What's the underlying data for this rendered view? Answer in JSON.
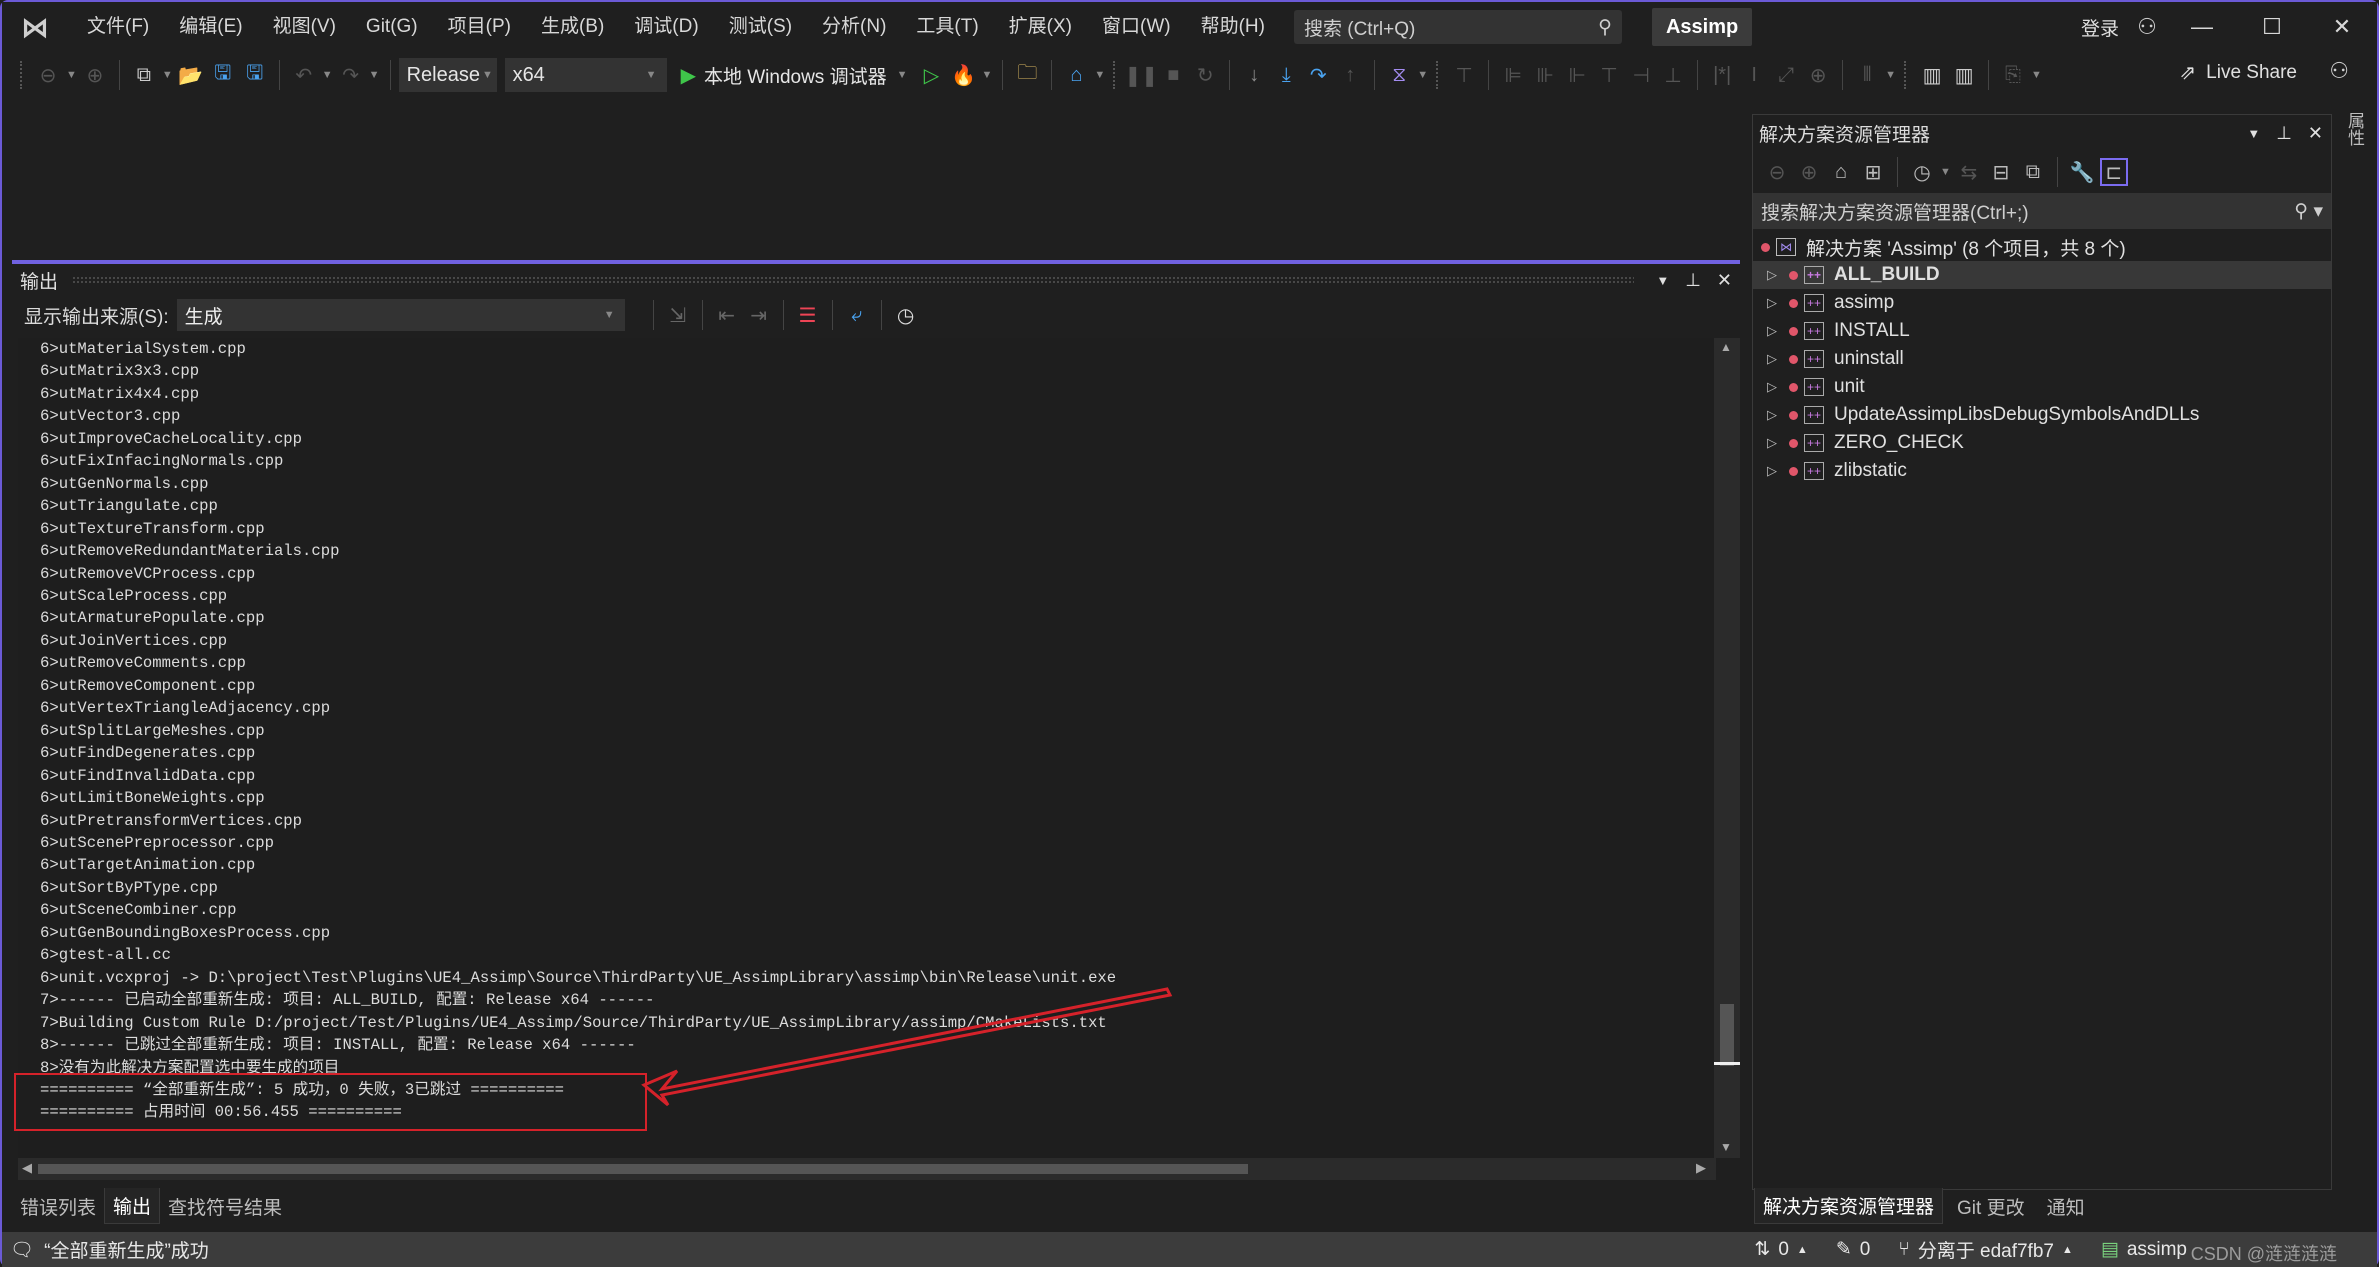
{
  "titlebar": {
    "menus": [
      "文件(F)",
      "编辑(E)",
      "视图(V)",
      "Git(G)",
      "项目(P)",
      "生成(B)",
      "调试(D)",
      "测试(S)",
      "分析(N)",
      "工具(T)",
      "扩展(X)",
      "窗口(W)",
      "帮助(H)"
    ],
    "search_placeholder": "搜索 (Ctrl+Q)",
    "solution_name": "Assimp",
    "login_label": "登录",
    "minimize": "—",
    "maximize": "☐",
    "close": "✕"
  },
  "toolbar": {
    "configuration": "Release",
    "platform": "x64",
    "run_label": "本地 Windows 调试器",
    "live_share": "Live Share"
  },
  "output_panel": {
    "title": "输出",
    "source_label": "显示输出来源(S):",
    "source_value": "生成",
    "lines": [
      "6>utMaterialSystem.cpp",
      "6>utMatrix3x3.cpp",
      "6>utMatrix4x4.cpp",
      "6>utVector3.cpp",
      "6>utImproveCacheLocality.cpp",
      "6>utFixInfacingNormals.cpp",
      "6>utGenNormals.cpp",
      "6>utTriangulate.cpp",
      "6>utTextureTransform.cpp",
      "6>utRemoveRedundantMaterials.cpp",
      "6>utRemoveVCProcess.cpp",
      "6>utScaleProcess.cpp",
      "6>utArmaturePopulate.cpp",
      "6>utJoinVertices.cpp",
      "6>utRemoveComments.cpp",
      "6>utRemoveComponent.cpp",
      "6>utVertexTriangleAdjacency.cpp",
      "6>utSplitLargeMeshes.cpp",
      "6>utFindDegenerates.cpp",
      "6>utFindInvalidData.cpp",
      "6>utLimitBoneWeights.cpp",
      "6>utPretransformVertices.cpp",
      "6>utScenePreprocessor.cpp",
      "6>utTargetAnimation.cpp",
      "6>utSortByPType.cpp",
      "6>utSceneCombiner.cpp",
      "6>utGenBoundingBoxesProcess.cpp",
      "6>gtest-all.cc",
      "6>unit.vcxproj -> D:\\project\\Test\\Plugins\\UE4_Assimp\\Source\\ThirdParty\\UE_AssimpLibrary\\assimp\\bin\\Release\\unit.exe",
      "7>------ 已启动全部重新生成: 项目: ALL_BUILD, 配置: Release x64 ------",
      "7>Building Custom Rule D:/project/Test/Plugins/UE4_Assimp/Source/ThirdParty/UE_AssimpLibrary/assimp/CMakeLists.txt",
      "8>------ 已跳过全部重新生成: 项目: INSTALL, 配置: Release x64 ------",
      "8>没有为此解决方案配置选中要生成的项目",
      "========== “全部重新生成”: 5 成功，0 失败，3已跳过 ==========",
      "========== 占用时间 00:56.455 =========="
    ]
  },
  "bottom_tabs": [
    "错误列表",
    "输出",
    "查找符号结果"
  ],
  "solution_explorer": {
    "title": "解决方案资源管理器",
    "search_placeholder": "搜索解决方案资源管理器(Ctrl+;)",
    "root": "解决方案 'Assimp' (8 个项目，共 8 个)",
    "projects": [
      "ALL_BUILD",
      "assimp",
      "INSTALL",
      "uninstall",
      "unit",
      "UpdateAssimpLibsDebugSymbolsAndDLLs",
      "ZERO_CHECK",
      "zlibstatic"
    ],
    "selected": "ALL_BUILD",
    "tabs": [
      "解决方案资源管理器",
      "Git 更改",
      "通知"
    ]
  },
  "properties_strip": "属性",
  "statusbar": {
    "message": "“全部重新生成”成功",
    "push_count": "0",
    "changes_count": "0",
    "branch": "分离于 edaf7fb7",
    "repo": "assimp",
    "watermark": "CSDN @涟涟涟涟"
  },
  "colors": {
    "accent": "#7061e0",
    "annotation": "#d5222a",
    "error_dot": "#e0566a",
    "run_green": "#3fc64a"
  }
}
